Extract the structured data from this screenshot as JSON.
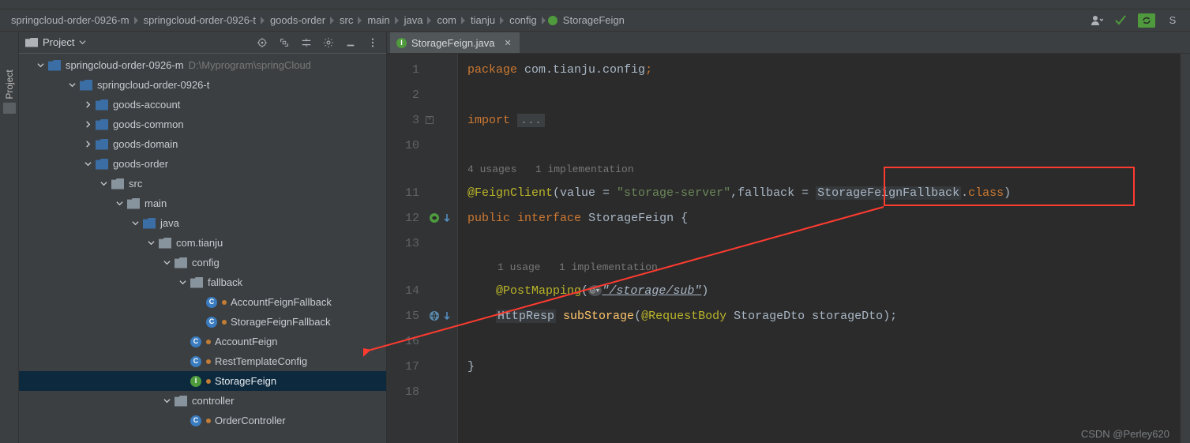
{
  "breadcrumb": {
    "items": [
      "springcloud-order-0926-m",
      "springcloud-order-0926-t",
      "goods-order",
      "src",
      "main",
      "java",
      "com",
      "tianju",
      "config",
      "StorageFeign"
    ]
  },
  "project": {
    "title": "Project",
    "rail_label": "Project",
    "root": {
      "name": "springcloud-order-0926-m",
      "path": "D:\\Myprogram\\springCloud"
    },
    "nodes": [
      {
        "indent": 2,
        "chev": "down",
        "icon": "module",
        "label": "springcloud-order-0926-t"
      },
      {
        "indent": 3,
        "chev": "right",
        "icon": "module",
        "label": "goods-account"
      },
      {
        "indent": 3,
        "chev": "right",
        "icon": "module",
        "label": "goods-common"
      },
      {
        "indent": 3,
        "chev": "right",
        "icon": "module",
        "label": "goods-domain"
      },
      {
        "indent": 3,
        "chev": "down",
        "icon": "module",
        "label": "goods-order"
      },
      {
        "indent": 4,
        "chev": "down",
        "icon": "folder",
        "label": "src"
      },
      {
        "indent": 5,
        "chev": "down",
        "icon": "folder",
        "label": "main"
      },
      {
        "indent": 6,
        "chev": "down",
        "icon": "folder-src",
        "label": "java"
      },
      {
        "indent": 7,
        "chev": "down",
        "icon": "pkg",
        "label": "com.tianju"
      },
      {
        "indent": 8,
        "chev": "down",
        "icon": "pkg",
        "label": "config"
      },
      {
        "indent": 9,
        "chev": "down",
        "icon": "pkg",
        "label": "fallback"
      },
      {
        "indent": 10,
        "chev": "none",
        "icon": "class-blue",
        "label": "AccountFeignFallback",
        "mod": true
      },
      {
        "indent": 10,
        "chev": "none",
        "icon": "class-blue",
        "label": "StorageFeignFallback",
        "mod": true
      },
      {
        "indent": 9,
        "chev": "none",
        "icon": "class-blue",
        "label": "AccountFeign",
        "mod": true
      },
      {
        "indent": 9,
        "chev": "none",
        "icon": "class-blue",
        "label": "RestTemplateConfig",
        "mod": true
      },
      {
        "indent": 9,
        "chev": "none",
        "icon": "class-green",
        "label": "StorageFeign",
        "mod": true,
        "selected": true
      },
      {
        "indent": 8,
        "chev": "down",
        "icon": "pkg",
        "label": "controller"
      },
      {
        "indent": 9,
        "chev": "none",
        "icon": "class-blue",
        "label": "OrderController",
        "mod": true
      }
    ]
  },
  "editor": {
    "tab": {
      "label": "StorageFeign.java"
    },
    "gutter": [
      "1",
      "2",
      "3",
      "10",
      "",
      "11",
      "12",
      "13",
      "",
      "14",
      "15",
      "16",
      "17",
      "18"
    ],
    "hints": {
      "class": "4 usages   1 implementation",
      "method": "1 usage   1 implementation"
    },
    "code": {
      "package_kw": "package",
      "package_name": "com.tianju.config",
      "import_kw": "import",
      "ellipsis": "...",
      "ann_feign": "@FeignClient",
      "feign_params_pre": "(value = ",
      "feign_value": "\"storage-server\"",
      "feign_params_mid": ",fallback = ",
      "fallback_class": "StorageFeignFallback",
      "dot": ".",
      "class_kw": "class",
      "close_paren": ")",
      "public_kw": "public",
      "interface_kw": "interface",
      "class_name": "StorageFeign",
      "brace_open": "{",
      "brace_close": "}",
      "ann_post": "@PostMapping",
      "post_open": "(",
      "post_icon": "◎▾",
      "post_path": "\"/storage/sub\"",
      "post_close": ")",
      "ret_type": "HttpResp",
      "method_name": "subStorage",
      "method_open": "(",
      "ann_body": "@RequestBody",
      "param_type": "StorageDto",
      "param_name": "storageDto",
      "method_close": ");",
      "semi": ";"
    }
  },
  "watermark": "CSDN @Perley620"
}
